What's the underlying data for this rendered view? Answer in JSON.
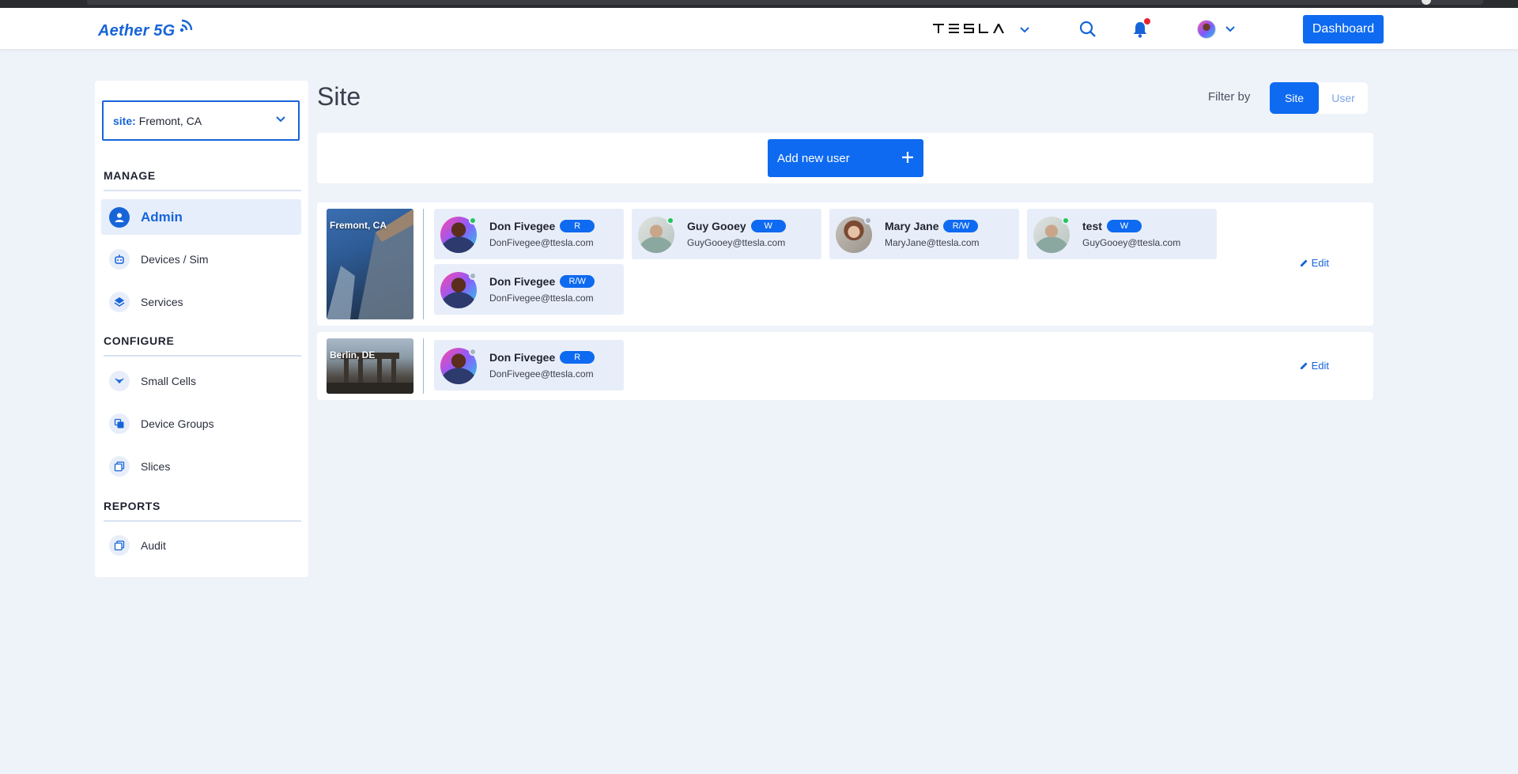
{
  "app": {
    "logo_text": "Aether 5G",
    "brand_name": "TESLA",
    "dashboard_label": "Dashboard"
  },
  "sidebar": {
    "site_label": "site:",
    "site_value": "Fremont, CA",
    "sections": [
      {
        "title": "MANAGE",
        "items": [
          {
            "label": "Admin",
            "icon": "user-icon",
            "active": true
          },
          {
            "label": "Devices / Sim",
            "icon": "robot-icon"
          },
          {
            "label": "Services",
            "icon": "layers-icon"
          }
        ]
      },
      {
        "title": "CONFIGURE",
        "items": [
          {
            "label": "Small Cells",
            "icon": "signal-icon"
          },
          {
            "label": "Device Groups",
            "icon": "device-groups-icon"
          },
          {
            "label": "Slices",
            "icon": "slices-icon"
          }
        ]
      },
      {
        "title": "REPORTS",
        "items": [
          {
            "label": "Audit",
            "icon": "audit-icon"
          }
        ]
      }
    ]
  },
  "main": {
    "title": "Site",
    "filter_label": "Filter by",
    "filter_options": [
      "Site",
      "User"
    ],
    "filter_selected": "Site",
    "add_user_label": "Add new user",
    "edit_label": "Edit",
    "sites": [
      {
        "name": "Fremont, CA",
        "users": [
          {
            "name": "Don Fivegee",
            "permission": "R",
            "email": "DonFivegee@ttesla.com",
            "status": "online"
          },
          {
            "name": "Guy Gooey",
            "permission": "W",
            "email": "GuyGooey@ttesla.com",
            "status": "online"
          },
          {
            "name": "Mary Jane",
            "permission": "R/W",
            "email": "MaryJane@ttesla.com",
            "status": "offline"
          },
          {
            "name": "test",
            "permission": "W",
            "email": "GuyGooey@ttesla.com",
            "status": "online"
          },
          {
            "name": "Don Fivegee",
            "permission": "R/W",
            "email": "DonFivegee@ttesla.com",
            "status": "offline"
          }
        ]
      },
      {
        "name": "Berlin, DE",
        "users": [
          {
            "name": "Don Fivegee",
            "permission": "R",
            "email": "DonFivegee@ttesla.com",
            "status": "offline"
          }
        ]
      }
    ]
  },
  "colors": {
    "accent": "#0e6af0",
    "status_online": "#1ec65a",
    "status_offline": "#a8b3c4"
  }
}
